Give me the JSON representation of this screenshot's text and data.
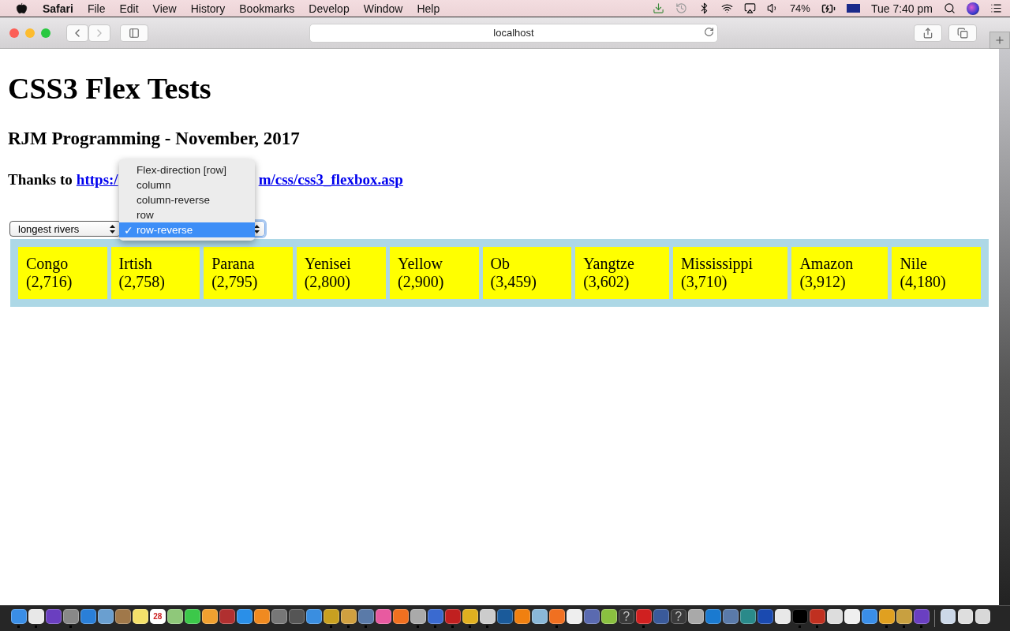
{
  "menu_bar": {
    "app": "Safari",
    "items": [
      "File",
      "Edit",
      "View",
      "History",
      "Bookmarks",
      "Develop",
      "Window",
      "Help"
    ],
    "battery": "74%",
    "clock": "Tue 7:40 pm"
  },
  "toolbar": {
    "address": "localhost"
  },
  "page": {
    "title": "CSS3 Flex Tests",
    "subtitle": "RJM Programming - November, 2017",
    "thanks": "Thanks to",
    "link_start": "https:/",
    "link_end": "m/css/css3_flexbox.asp",
    "list_select": {
      "value": "longest rivers"
    },
    "direction_menu": {
      "options": [
        {
          "label": "Flex-direction [row]",
          "selected": false
        },
        {
          "label": "column",
          "selected": false
        },
        {
          "label": "column-reverse",
          "selected": false
        },
        {
          "label": "row",
          "selected": false
        },
        {
          "label": "row-reverse",
          "selected": true
        }
      ],
      "check": "✓"
    },
    "rivers": [
      {
        "name": "Congo",
        "length": "(2,716)"
      },
      {
        "name": "Irtish",
        "length": "(2,758)"
      },
      {
        "name": "Parana",
        "length": "(2,795)"
      },
      {
        "name": "Yenisei",
        "length": "(2,800)"
      },
      {
        "name": "Yellow",
        "length": "(2,900)"
      },
      {
        "name": "Ob",
        "length": "(3,459)"
      },
      {
        "name": "Yangtze",
        "length": "(3,602)"
      },
      {
        "name": "Mississippi",
        "length": "(3,710)"
      },
      {
        "name": "Amazon",
        "length": "(3,912)"
      },
      {
        "name": "Nile",
        "length": "(4,180)"
      }
    ]
  },
  "dock": [
    {
      "color": "#3a8ee6",
      "running": true
    },
    {
      "color": "#e8e8e8",
      "running": true
    },
    {
      "color": "#6a3fc0",
      "running": false
    },
    {
      "color": "#888888",
      "running": true
    },
    {
      "color": "#2a7fd8",
      "running": false
    },
    {
      "color": "#6a9fd0",
      "running": false
    },
    {
      "color": "#a0784a",
      "running": false
    },
    {
      "color": "#f5e16a",
      "running": false
    },
    {
      "color": "#ffffff",
      "running": false,
      "glyph": "28"
    },
    {
      "color": "#8fc87a",
      "running": false
    },
    {
      "color": "#3cc84a",
      "running": false
    },
    {
      "color": "#f0a030",
      "running": false
    },
    {
      "color": "#b03030",
      "running": false
    },
    {
      "color": "#2a8fe8",
      "running": false
    },
    {
      "color": "#f08a20",
      "running": false
    },
    {
      "color": "#777777",
      "running": false
    },
    {
      "color": "#555555",
      "running": false
    },
    {
      "color": "#3a8ee0",
      "running": false
    },
    {
      "color": "#c8a020",
      "running": true
    },
    {
      "color": "#d0a040",
      "running": true
    },
    {
      "color": "#5a7aa8",
      "running": true
    },
    {
      "color": "#e85aa0",
      "running": false
    },
    {
      "color": "#f07020",
      "running": false
    },
    {
      "color": "#aaaaaa",
      "running": true
    },
    {
      "color": "#3a6ad0",
      "running": true
    },
    {
      "color": "#c02020",
      "running": true
    },
    {
      "color": "#e0b020",
      "running": true
    },
    {
      "color": "#cccccc",
      "running": true
    },
    {
      "color": "#1a5a9a",
      "running": false
    },
    {
      "color": "#f08010",
      "running": false
    },
    {
      "color": "#8ab8d8",
      "running": false
    },
    {
      "color": "#f07021",
      "running": true
    },
    {
      "color": "#eeeeee",
      "running": false
    },
    {
      "color": "#5a6ab0",
      "running": false
    },
    {
      "color": "#8ac040",
      "running": false
    },
    {
      "color": "#3a3a3a",
      "running": false,
      "glyph": "?"
    },
    {
      "color": "#d02020",
      "running": true
    },
    {
      "color": "#3a5a9a",
      "running": false
    },
    {
      "color": "#3a3a3b",
      "running": false,
      "glyph": "?"
    },
    {
      "color": "#a9a9a9",
      "running": false
    },
    {
      "color": "#1a7ad0",
      "running": false
    },
    {
      "color": "#5a7aa9",
      "running": false
    },
    {
      "color": "#2a8a8a",
      "running": false
    },
    {
      "color": "#1a4ab0",
      "running": false
    },
    {
      "color": "#e8e8e8",
      "running": false
    },
    {
      "color": "#000000",
      "running": true
    },
    {
      "color": "#c03020",
      "running": true
    },
    {
      "color": "#dddddd",
      "running": false
    },
    {
      "color": "#efefef",
      "running": false
    },
    {
      "color": "#3a8ee8",
      "running": false
    },
    {
      "color": "#e0a020",
      "running": true
    },
    {
      "color": "#c8a040",
      "running": true
    },
    {
      "color": "#6a3fc1",
      "running": true
    },
    {
      "color": "#ccd8e8",
      "running": false,
      "kind": "stack"
    },
    {
      "color": "#dedede",
      "running": false,
      "kind": "stack"
    },
    {
      "color": "#d8d8d8",
      "running": false,
      "kind": "stack"
    }
  ]
}
